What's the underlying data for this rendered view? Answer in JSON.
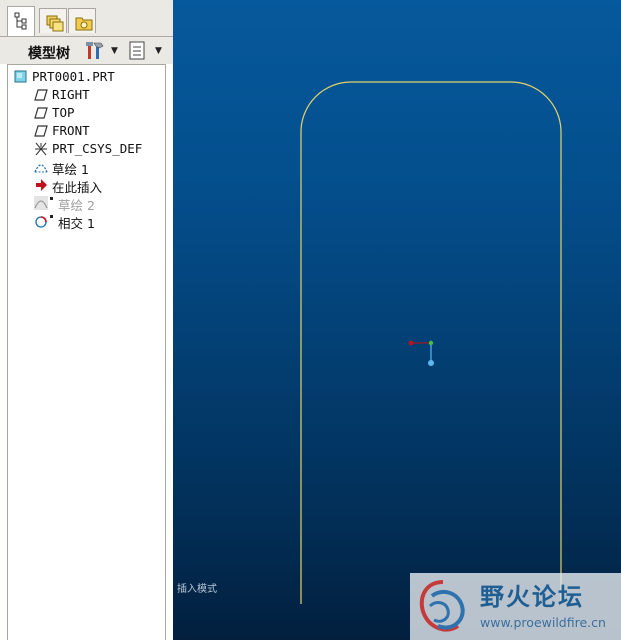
{
  "tabs": [
    {
      "icon": "model-tree-icon",
      "active": true
    },
    {
      "icon": "folder-browser-icon",
      "active": false
    },
    {
      "icon": "favorites-icon",
      "active": false
    }
  ],
  "toolbar": {
    "title": "模型树",
    "settings_icon": "settings-icon",
    "show_icon": "show-list-icon",
    "dropdown_glyph": "▼"
  },
  "tree": {
    "items": [
      {
        "label": "PRT0001.PRT",
        "icon": "part-icon",
        "indent": 0,
        "dim": false
      },
      {
        "label": "RIGHT",
        "icon": "datum-plane-icon",
        "indent": 1,
        "dim": false
      },
      {
        "label": "TOP",
        "icon": "datum-plane-icon",
        "indent": 1,
        "dim": false
      },
      {
        "label": "FRONT",
        "icon": "datum-plane-icon",
        "indent": 1,
        "dim": false
      },
      {
        "label": "PRT_CSYS_DEF",
        "icon": "coordinate-system-icon",
        "indent": 1,
        "dim": false
      },
      {
        "label": "草绘 1",
        "icon": "sketch-icon",
        "indent": 1,
        "dim": false
      },
      {
        "label": "在此插入",
        "icon": "insert-arrow-icon",
        "indent": 1,
        "dim": false
      },
      {
        "label": "草绘 2",
        "icon": "sketch-icon",
        "indent": 1,
        "dim": true
      },
      {
        "label": "相交 1",
        "icon": "intersect-icon",
        "indent": 1,
        "dim": false
      }
    ]
  },
  "viewport": {
    "mode_text": "插入模式",
    "sketch_color": "#e4d36a",
    "bg_top": "#06599c",
    "bg_bottom": "#021f3e"
  },
  "watermark": {
    "name": "野火论坛",
    "url": "www.proewildfire.cn"
  }
}
